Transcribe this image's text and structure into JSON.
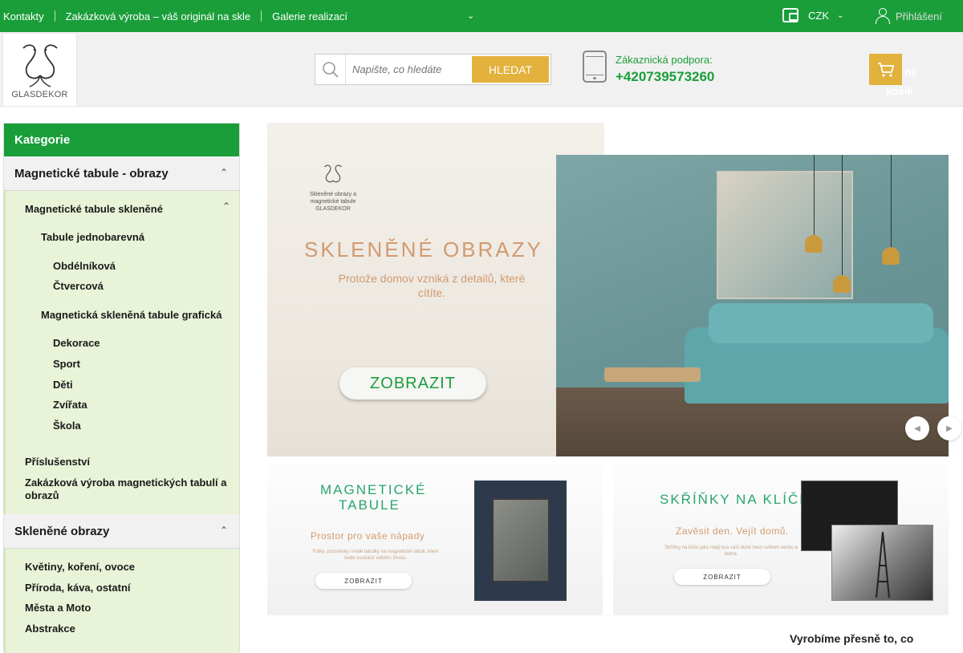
{
  "topbar": {
    "links": [
      "Kontakty",
      "Zakázková výroba – váš originál na skle",
      "Galerie realizací"
    ],
    "currency": "CZK",
    "login": "Přihlášení"
  },
  "header": {
    "logo_text": "GLASDEKOR",
    "search": {
      "placeholder": "Napište, co hledáte",
      "button": "HLEDAT"
    },
    "support": {
      "label": "Zákaznická podpora:",
      "phone": "+420739573260"
    },
    "cart": {
      "line1": "ný",
      "line2": "košík"
    }
  },
  "sidebar": {
    "title": "Kategorie",
    "sections": [
      {
        "label": "Magnetické tabule - obrazy"
      },
      {
        "label": "Skleněné obrazy"
      }
    ],
    "items": [
      {
        "label": "Magnetické tabule skleněné"
      },
      {
        "label": "Tabule jednobarevná"
      },
      {
        "label": "Obdélníková"
      },
      {
        "label": "Čtvercová"
      },
      {
        "label": "Magnetická skleněná tabule grafická"
      },
      {
        "label": "Dekorace"
      },
      {
        "label": "Sport"
      },
      {
        "label": "Děti"
      },
      {
        "label": "Zvířata"
      },
      {
        "label": "Škola"
      },
      {
        "label": "Příslušenství"
      },
      {
        "label": "Zakázková výroba magnetických tabulí a obrazů"
      },
      {
        "label": "Květiny, koření, ovoce"
      },
      {
        "label": "Příroda, káva, ostatní"
      },
      {
        "label": "Města a Moto"
      },
      {
        "label": "Abstrakce"
      }
    ]
  },
  "hero": {
    "logo_text": "Skleněné obrazy a magnetické tabule GLASDEKOR",
    "title": "SKLENĚNÉ OBRAZY",
    "subtitle": "Protože domov vzniká z detailů, které cítíte.",
    "button": "ZOBRAZIT"
  },
  "banners": [
    {
      "title1": "MAGNETICKÉ",
      "title2": "TABULE",
      "subtitle": "Prostor pro vaše nápady",
      "small": "Fotky, poznámky i malé tabulky na magnetické tabuli, které bude součástí vašeho života.",
      "button": "ZOBRAZIT"
    },
    {
      "title1": "SKŘÍŇKY NA KLÍČE",
      "subtitle": "Zavěsit den. Vejít domů.",
      "small": "Skříňky na klíče jako malý kus vaší duše mezi světem venku a doma.",
      "button": "ZOBRAZIT"
    }
  ],
  "footer_text": "Vyrobíme přesně to, co",
  "colors": {
    "green": "#1a9e3a",
    "gold": "#e3b23c",
    "sidebar_bg": "#f1f1f1",
    "submenu_bg": "#e8f3d8"
  }
}
